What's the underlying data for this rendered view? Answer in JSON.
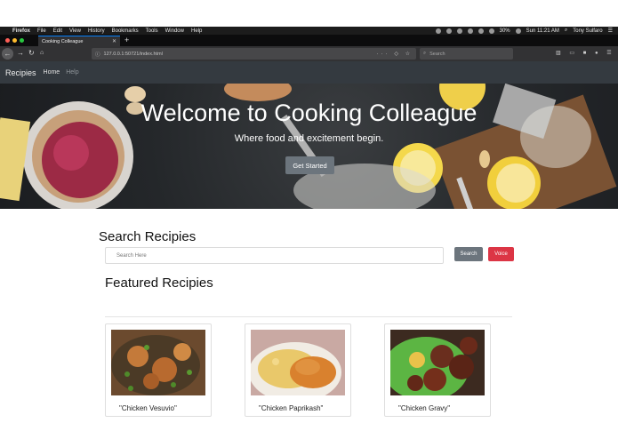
{
  "menubar": {
    "app": "Firefox",
    "items": [
      "File",
      "Edit",
      "View",
      "History",
      "Bookmarks",
      "Tools",
      "Window",
      "Help"
    ],
    "battery": "30%",
    "clock": "Sun 11:21 AM",
    "user": "Tony Sulfaro"
  },
  "browser": {
    "tab_title": "Cooking Colleague",
    "url": "127.0.0.1:50721/index.html",
    "search_placeholder": "Search"
  },
  "site": {
    "brand": "Recipies",
    "nav": [
      "Home",
      "Help"
    ]
  },
  "hero": {
    "title": "Welcome to Cooking Colleague",
    "subtitle": "Where food and excitement begin.",
    "button": "Get Started"
  },
  "search": {
    "heading": "Search Recipies",
    "placeholder": "Search Here",
    "search_button": "Search",
    "voice_button": "Voice"
  },
  "featured": {
    "heading": "Featured Recipies",
    "cards": [
      {
        "title": "\"Chicken Vesuvio\""
      },
      {
        "title": "\"Chicken Paprikash\""
      },
      {
        "title": "\"Chicken Gravy\""
      }
    ]
  },
  "colors": {
    "navbar": "#343a40",
    "secondary": "#6c757d",
    "danger": "#dc3545"
  }
}
